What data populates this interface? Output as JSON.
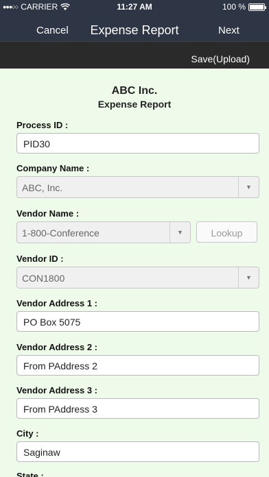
{
  "status_bar": {
    "carrier": "CARRIER",
    "time": "11:27 AM",
    "battery": "100 %",
    "signal_icon": "signal-dots",
    "wifi_icon": "wifi-icon",
    "battery_icon": "battery-icon"
  },
  "nav": {
    "cancel": "Cancel",
    "title": "Expense Report",
    "next": "Next"
  },
  "toolbar": {
    "save": "Save(Upload)"
  },
  "header": {
    "company": "ABC Inc.",
    "subtitle": "Expense Report"
  },
  "form": {
    "process_id": {
      "label": "Process ID :",
      "value": "PID30"
    },
    "company_name": {
      "label": "Company Name :",
      "value": "ABC, Inc."
    },
    "vendor_name": {
      "label": "Vendor Name :",
      "value": "1-800-Conference",
      "lookup": "Lookup"
    },
    "vendor_id": {
      "label": "Vendor ID :",
      "value": "CON1800"
    },
    "vendor_address_1": {
      "label": "Vendor Address 1 :",
      "value": "PO Box 5075"
    },
    "vendor_address_2": {
      "label": "Vendor Address 2 :",
      "value": "From PAddress 2"
    },
    "vendor_address_3": {
      "label": "Vendor Address 3 :",
      "value": "From PAddress 3"
    },
    "city": {
      "label": "City :",
      "value": "Saginaw"
    },
    "state": {
      "label": "State :"
    }
  },
  "colors": {
    "nav_bg": "#2e3545",
    "toolbar_bg": "#2a2a2a",
    "page_bg": "#effbea"
  }
}
